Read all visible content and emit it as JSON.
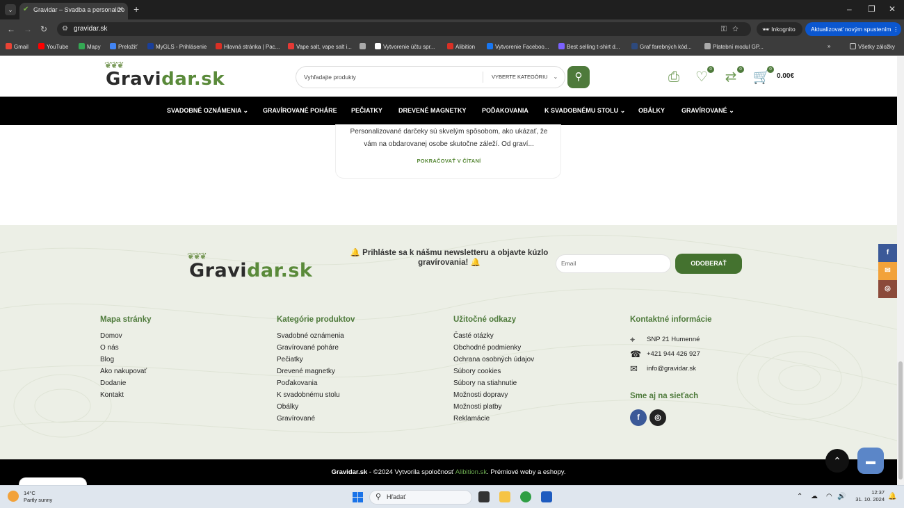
{
  "browser": {
    "tab_title": "Gravidar – Svadba a personalizo",
    "url": "gravidar.sk",
    "incognito": "Inkognito",
    "update": "Aktualizovať novým spustením",
    "bookmarks": [
      {
        "label": "Gmail",
        "color": "#ea4335"
      },
      {
        "label": "YouTube",
        "color": "#ff0000"
      },
      {
        "label": "Mapy",
        "color": "#34a853"
      },
      {
        "label": "Preložiť",
        "color": "#4285f4"
      },
      {
        "label": "MyGLS - Prihlásenie",
        "color": "#1a3f9a"
      },
      {
        "label": "Hlavná stránka | Pac...",
        "color": "#d93025"
      },
      {
        "label": "Vape salt, vape salt i...",
        "color": "#e53935"
      },
      {
        "label": "",
        "color": "#aaaaaa"
      },
      {
        "label": "Vytvorenie účtu spr...",
        "color": "#ffffff"
      },
      {
        "label": "Alibition",
        "color": "#d93025"
      },
      {
        "label": "Vytvorenie Faceboo...",
        "color": "#1877f2"
      },
      {
        "label": "Best selling t-shirt d...",
        "color": "#7b61ff"
      },
      {
        "label": "Graf farebných kód...",
        "color": "#2e4a7d"
      },
      {
        "label": "Platební modul GP...",
        "color": "#aaaaaa"
      }
    ],
    "all_bookmarks": "Všetky záložky"
  },
  "header": {
    "logo_a": "Gravi",
    "logo_b": "dar.sk",
    "search_placeholder": "Vyhľadajte produkty",
    "category_select": "VYBERTE KATEGÓRIU",
    "wishlist_count": "0",
    "compare_count": "0",
    "cart_count": "0",
    "cart_total": "0.00€"
  },
  "menu": [
    {
      "label": "SVADOBNÉ OZNÁMENIA",
      "dropdown": true
    },
    {
      "label": "GRAVÍROVANÉ POHÁRE",
      "dropdown": false
    },
    {
      "label": "PEČIATKY",
      "dropdown": false
    },
    {
      "label": "DREVENÉ MAGNETKY",
      "dropdown": false
    },
    {
      "label": "POĎAKOVANIA",
      "dropdown": false
    },
    {
      "label": "K SVADOBNÉMU STOLU",
      "dropdown": true
    },
    {
      "label": "OBÁLKY",
      "dropdown": false
    },
    {
      "label": "GRAVÍROVANÉ",
      "dropdown": true
    }
  ],
  "post_card": {
    "excerpt": "Personalizované darčeky sú skvelým spôsobom, ako ukázať, že vám na obdarovanej osobe skutočne záleží. Od graví...",
    "read_more": "POKRAČOVAŤ V ČÍTANÍ"
  },
  "newsletter": {
    "text": "🔔 Prihláste sa k nášmu newsletteru a objavte kúzlo gravírovania! 🔔",
    "email_placeholder": "Email",
    "subscribe": "ODOBERAŤ"
  },
  "footer_columns": [
    {
      "title": "Mapa stránky",
      "items": [
        "Domov",
        "O nás",
        "Blog",
        "Ako nakupovať",
        "Dodanie",
        "Kontakt"
      ]
    },
    {
      "title": "Kategórie produktov",
      "items": [
        "Svadobné oznámenia",
        "Gravírované poháre",
        "Pečiatky",
        "Drevené magnetky",
        "Poďakovania",
        "K svadobnému stolu",
        "Obálky",
        "Gravírované"
      ]
    },
    {
      "title": "Užitočné odkazy",
      "items": [
        "Časté otázky",
        "Obchodné podmienky",
        "Ochrana osobných údajov",
        "Súbory cookies",
        "Súbory na stiahnutie",
        "Možnosti dopravy",
        "Možnosti platby",
        "Reklamácie"
      ]
    }
  ],
  "contact": {
    "title": "Kontaktné informácie",
    "address": "SNP 21 Humenné",
    "phone": "+421 944 426 927",
    "email": "info@gravidar.sk",
    "social_title": "Sme aj na sieťach"
  },
  "copyright": {
    "brand": "Gravidar.sk",
    "mid": " - ©2024 Vytvorila spoločnosť ",
    "company": "Alibition.sk",
    "tail": ". Prémiové weby a eshopy."
  },
  "taskbar": {
    "temp": "14°C",
    "weather": "Partly sunny",
    "search": "Hľadať",
    "time": "12:37",
    "date": "31. 10. 2024"
  },
  "colors": {
    "brand_green": "#4e7a3b",
    "footer_bg": "#ecefe6",
    "facebook": "#3b5998",
    "email_side": "#f2a23a",
    "instagram_side": "#8b4a3a"
  }
}
